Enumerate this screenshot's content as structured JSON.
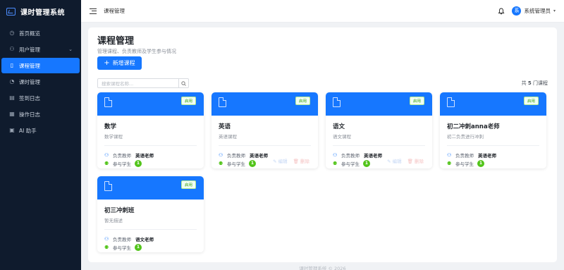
{
  "brand": {
    "title": "课时管理系统"
  },
  "sidebar": {
    "items": [
      {
        "label": "首页概览",
        "icon": "dashboard-icon",
        "glyph": "◷"
      },
      {
        "label": "用户管理",
        "icon": "users-icon",
        "glyph": "⚇"
      },
      {
        "label": "课程管理",
        "icon": "book-icon",
        "glyph": "▯"
      },
      {
        "label": "课时管理",
        "icon": "clock-icon",
        "glyph": "◔"
      },
      {
        "label": "签到日志",
        "icon": "document-icon",
        "glyph": "▤"
      },
      {
        "label": "操作日志",
        "icon": "file-edit-icon",
        "glyph": "▦"
      },
      {
        "label": "AI 助手",
        "icon": "robot-icon",
        "glyph": "▣"
      }
    ]
  },
  "header": {
    "breadcrumb": "课程管理",
    "user_avatar": "系",
    "user_name": "系统管理员"
  },
  "page": {
    "title": "课程管理",
    "subtitle": "管理课程、负责教师及学生参与情况",
    "add_button": "新增课程",
    "search_placeholder": "搜索课程名称...",
    "count_prefix": "共",
    "count_value": "5",
    "count_suffix": "门课程"
  },
  "card_labels": {
    "status": "启用",
    "teacher_label": "负责教师",
    "students_label": "参与学生",
    "edit": "编辑",
    "delete": "删除"
  },
  "courses": [
    {
      "name": "数学",
      "desc": "数学课程",
      "teacher": "英语老师",
      "students": "1"
    },
    {
      "name": "英语",
      "desc": "英语课程",
      "teacher": "英语老师",
      "students": "1"
    },
    {
      "name": "语文",
      "desc": "语文课程",
      "teacher": "英语老师",
      "students": "1"
    },
    {
      "name": "初二冲刺anna老师",
      "desc": "初二负责进行冲刺",
      "teacher": "英语老师",
      "students": "1"
    },
    {
      "name": "初三冲刺班",
      "desc": "暂无描述",
      "teacher": "语文老师",
      "students": "1"
    }
  ],
  "footer": {
    "text": "课时管理系统 © 2026"
  },
  "colors": {
    "primary": "#1677ff",
    "sidebar_bg": "#0f1b2d",
    "success": "#52c41a"
  }
}
